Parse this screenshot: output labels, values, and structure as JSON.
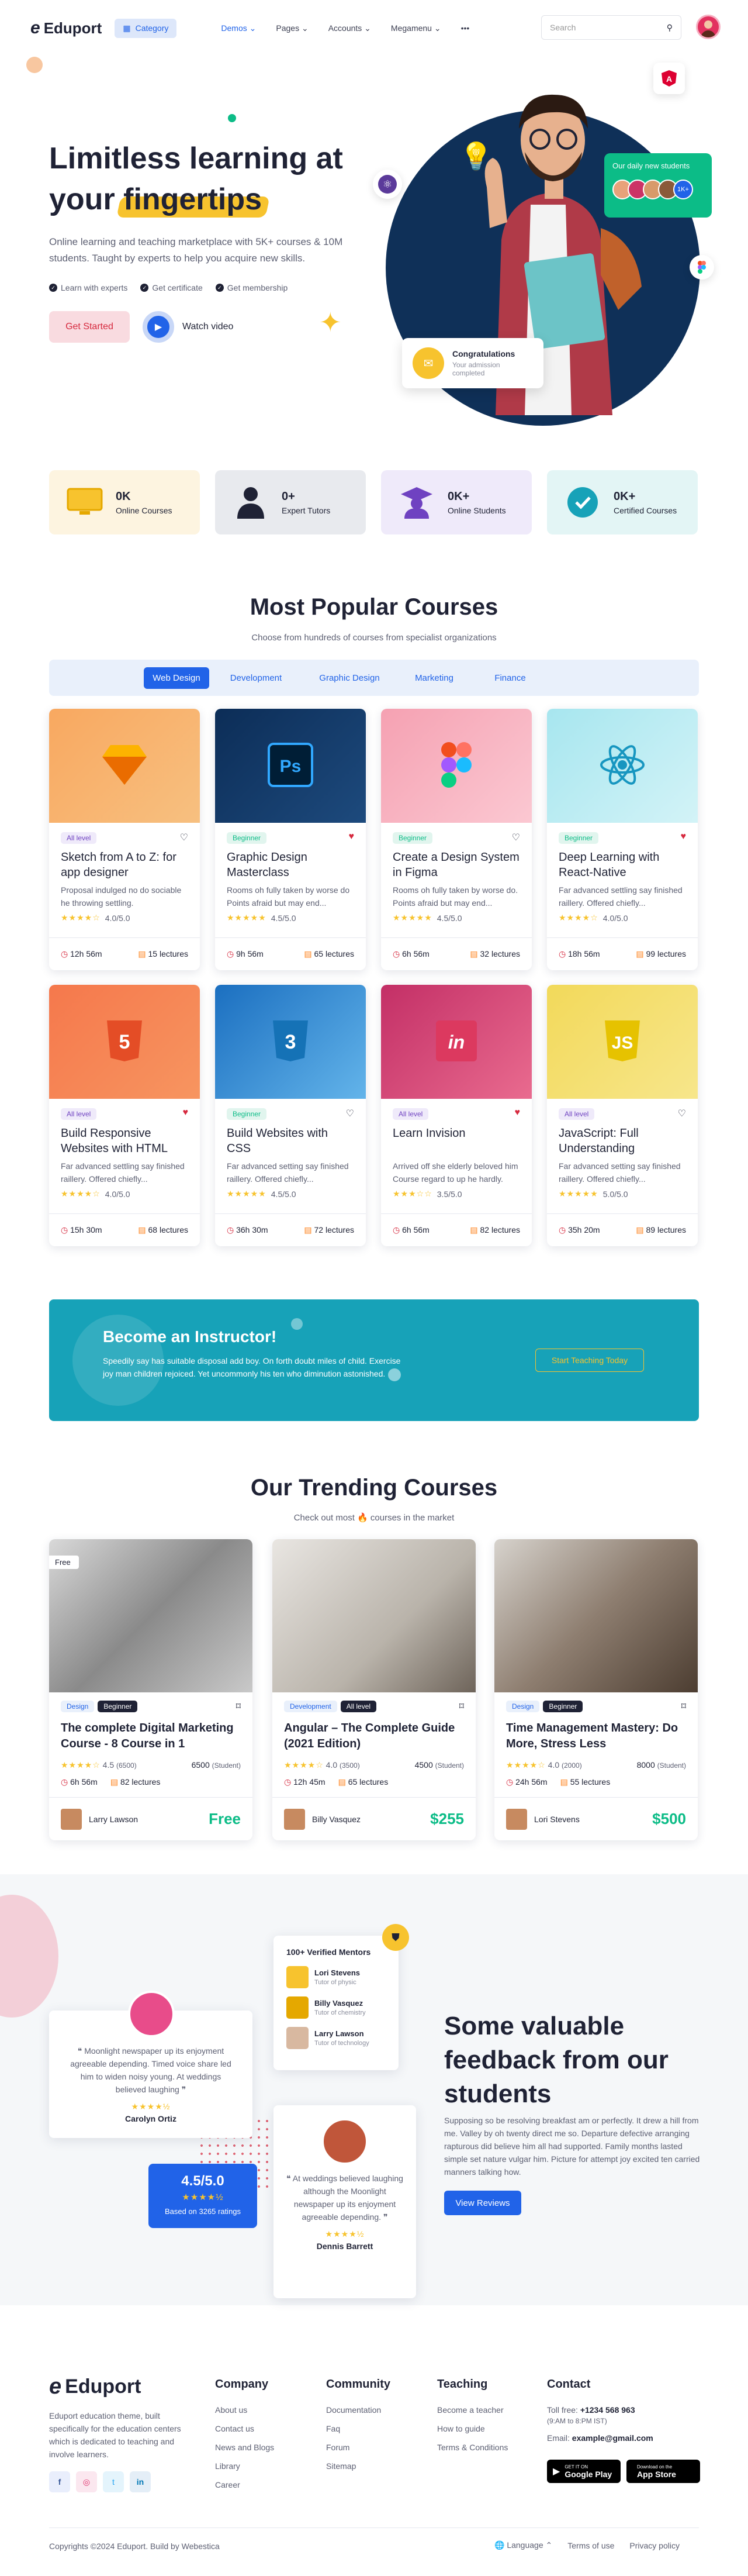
{
  "header": {
    "logo": "Eduport",
    "category": "Category",
    "nav": [
      "Demos",
      "Pages",
      "Accounts",
      "Megamenu"
    ],
    "more": "•••",
    "search_placeholder": "Search"
  },
  "hero": {
    "title_line1": "Limitless learning at",
    "title_line2_pre": "your ",
    "title_line2_hl": "fingertips",
    "subtitle": "Online learning and teaching marketplace with 5K+ courses & 10M students. Taught by experts to help you acquire new skills.",
    "checks": [
      "Learn with experts",
      "Get certificate",
      "Get membership"
    ],
    "start_btn": "Get Started",
    "watch": "Watch video",
    "daily_students": "Our daily new students",
    "daily_more": "1K+",
    "congrats_title": "Congratulations",
    "congrats_sub": "Your admission completed"
  },
  "stats": [
    {
      "num": "0K",
      "label": "Online Courses",
      "bg": "#fdf4e0"
    },
    {
      "num": "0+",
      "label": "Expert Tutors",
      "bg": "#e8eaee"
    },
    {
      "num": "0K+",
      "label": "Online Students",
      "bg": "#efeafa"
    },
    {
      "num": "0K+",
      "label": "Certified Courses",
      "bg": "#e3f5f5"
    }
  ],
  "popular": {
    "title": "Most Popular Courses",
    "subtitle": "Choose from hundreds of courses from specialist organizations",
    "tabs": [
      "Web Design",
      "Development",
      "Graphic Design",
      "Marketing",
      "Finance"
    ],
    "courses": [
      {
        "level": "All level",
        "title": "Sketch from A to Z: for app designer",
        "desc": "Proposal indulged no do sociable he throwing settling.",
        "rating": "4.0/5.0",
        "stars": "★★★★☆",
        "time": "12h 56m",
        "lectures": "15 lectures",
        "icon": "sketch-icon",
        "liked": false
      },
      {
        "level": "Beginner",
        "title": "Graphic Design Masterclass",
        "desc": "Rooms oh fully taken by worse do Points afraid but may end...",
        "rating": "4.5/5.0",
        "stars": "★★★★★",
        "time": "9h 56m",
        "lectures": "65 lectures",
        "icon": "photoshop-icon",
        "liked": true
      },
      {
        "level": "Beginner",
        "title": "Create a Design System in Figma",
        "desc": "Rooms oh fully taken by worse do. Points afraid but may end...",
        "rating": "4.5/5.0",
        "stars": "★★★★★",
        "time": "6h 56m",
        "lectures": "32 lectures",
        "icon": "figma-icon",
        "liked": false
      },
      {
        "level": "Beginner",
        "title": "Deep Learning with React-Native",
        "desc": "Far advanced settling say finished raillery. Offered chiefly...",
        "rating": "4.0/5.0",
        "stars": "★★★★☆",
        "time": "18h 56m",
        "lectures": "99 lectures",
        "icon": "react-icon",
        "liked": true
      },
      {
        "level": "All level",
        "title": "Build Responsive Websites with HTML",
        "desc": "Far advanced settling say finished raillery. Offered chiefly...",
        "rating": "4.0/5.0",
        "stars": "★★★★☆",
        "time": "15h 30m",
        "lectures": "68 lectures",
        "icon": "html5-icon",
        "liked": true
      },
      {
        "level": "Beginner",
        "title": "Build Websites with CSS",
        "desc": "Far advanced setting say finished raillery. Offered chiefly...",
        "rating": "4.5/5.0",
        "stars": "★★★★★",
        "time": "36h 30m",
        "lectures": "72 lectures",
        "icon": "css3-icon",
        "liked": false
      },
      {
        "level": "All level",
        "title": "Learn Invision",
        "desc": "Arrived off she elderly beloved him Course regard to up he hardly.",
        "rating": "3.5/5.0",
        "stars": "★★★☆☆",
        "time": "6h 56m",
        "lectures": "82 lectures",
        "icon": "invision-icon",
        "liked": true
      },
      {
        "level": "All level",
        "title": "JavaScript: Full Understanding",
        "desc": "Far advanced setting say finished raillery. Offered chiefly...",
        "rating": "5.0/5.0",
        "stars": "★★★★★",
        "time": "35h 20m",
        "lectures": "89 lectures",
        "icon": "javascript-icon",
        "liked": false
      }
    ]
  },
  "instructor": {
    "title": "Become an Instructor!",
    "text": "Speedily say has suitable disposal add boy. On forth doubt miles of child. Exercise joy man children rejoiced. Yet uncommonly his ten who diminution astonished.",
    "btn": "Start Teaching Today"
  },
  "trending": {
    "title": "Our Trending Courses",
    "subtitle": "Check out most 🔥 courses in the market",
    "courses": [
      {
        "tags": [
          "Design",
          "Beginner"
        ],
        "title": "The complete Digital Marketing Course - 8 Course in 1",
        "rating": "4.5",
        "reviews": "(6500)",
        "students": "6500",
        "students_lbl": "(Student)",
        "time": "6h 56m",
        "lectures": "82 lectures",
        "author": "Larry Lawson",
        "price": "Free",
        "free_tag": "Free"
      },
      {
        "tags": [
          "Development",
          "All level"
        ],
        "title": "Angular – The Complete Guide (2021 Edition)",
        "rating": "4.0",
        "reviews": "(3500)",
        "students": "4500",
        "students_lbl": "(Student)",
        "time": "12h 45m",
        "lectures": "65 lectures",
        "author": "Billy Vasquez",
        "price": "$255"
      },
      {
        "tags": [
          "Design",
          "Beginner"
        ],
        "title": "Time Management Mastery: Do More, Stress Less",
        "rating": "4.0",
        "reviews": "(2000)",
        "students": "8000",
        "students_lbl": "(Student)",
        "time": "24h 56m",
        "lectures": "55 lectures",
        "author": "Lori Stevens",
        "price": "$500"
      }
    ]
  },
  "testimonials": {
    "mentors_title": "100+ Verified Mentors",
    "mentors": [
      {
        "name": "Lori Stevens",
        "role": "Tutor of physic"
      },
      {
        "name": "Billy Vasquez",
        "role": "Tutor of chemistry"
      },
      {
        "name": "Larry Lawson",
        "role": "Tutor of technology"
      }
    ],
    "quote1": "Moonlight newspaper up its enjoyment agreeable depending. Timed voice share led him to widen noisy young. At weddings believed laughing",
    "name1": "Carolyn Ortiz",
    "quote2": "At weddings believed laughing although the Moonlight newspaper up its enjoyment agreeable depending.",
    "name2": "Dennis Barrett",
    "score": "4.5/5.0",
    "score_sub": "Based on 3265 ratings",
    "heading": "Some valuable feedback from our students",
    "text": "Supposing so be resolving breakfast am or perfectly. It drew a hill from me. Valley by oh twenty direct me so. Departure defective arranging rapturous did believe him all had supported. Family months lasted simple set nature vulgar him. Picture for attempt joy excited ten carried manners talking how.",
    "btn": "View Reviews"
  },
  "footer": {
    "logo": "Eduport",
    "about": "Eduport education theme, built specifically for the education centers which is dedicated to teaching and involve learners.",
    "company": {
      "title": "Company",
      "links": [
        "About us",
        "Contact us",
        "News and Blogs",
        "Library",
        "Career"
      ]
    },
    "community": {
      "title": "Community",
      "links": [
        "Documentation",
        "Faq",
        "Forum",
        "Sitemap"
      ]
    },
    "teaching": {
      "title": "Teaching",
      "links": [
        "Become a teacher",
        "How to guide",
        "Terms & Conditions"
      ]
    },
    "contact": {
      "title": "Contact",
      "toll_lbl": "Toll free: ",
      "toll": "+1234 568 963",
      "hours": "(9:AM to 8:PM IST)",
      "email_lbl": "Email: ",
      "email": "example@gmail.com"
    },
    "gplay_small": "GET IT ON",
    "gplay": "Google Play",
    "apple_small": "Download on the",
    "apple": "App Store",
    "copyright": "Copyrights ©2024 Eduport. Build by Webestica",
    "language": "Language",
    "terms": "Terms of use",
    "privacy": "Privacy policy"
  }
}
